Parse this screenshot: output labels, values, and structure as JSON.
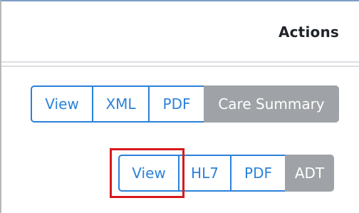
{
  "header": {
    "title": "Actions"
  },
  "row1": {
    "view": "View",
    "xml": "XML",
    "pdf": "PDF",
    "care_summary": "Care Summary"
  },
  "row2": {
    "view": "View",
    "hl7": "HL7",
    "pdf": "PDF",
    "adt": "ADT"
  },
  "colors": {
    "accent": "#2b82d9",
    "disabled": "#9fa2a6",
    "highlight": "#d7191c"
  }
}
